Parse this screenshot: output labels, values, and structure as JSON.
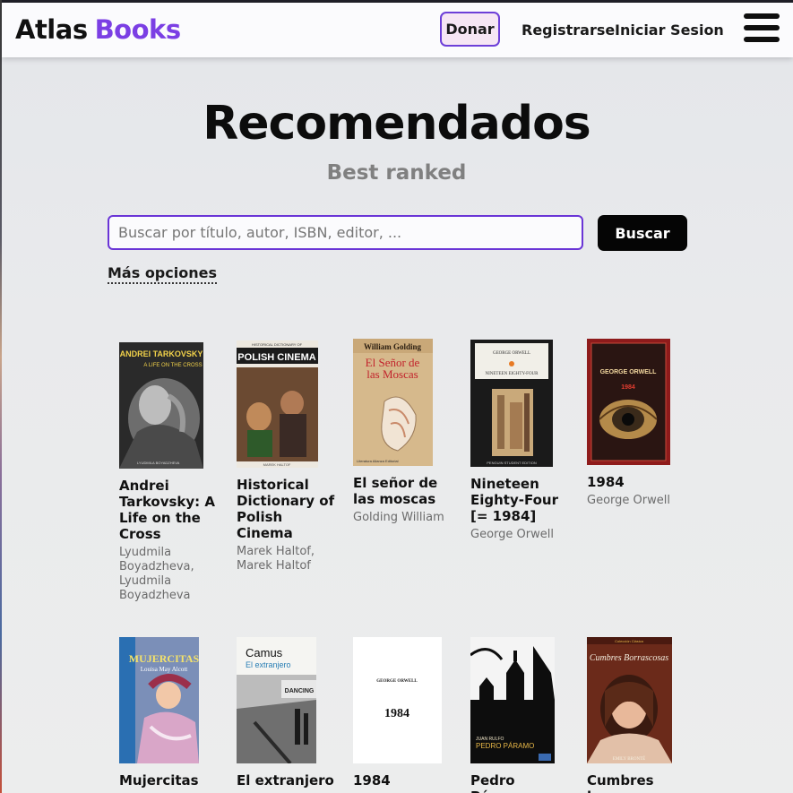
{
  "header": {
    "logo_part1": "Atlas",
    "logo_part2": "Books",
    "donate_label": "Donar",
    "register_label": "Registrarse",
    "login_label": "Iniciar Sesion",
    "menu_icon": "hamburger-menu-icon"
  },
  "main": {
    "title": "Recomendados",
    "subtitle": "Best ranked",
    "search": {
      "placeholder": "Buscar por título, autor, ISBN, editor, ...",
      "value": "",
      "button_label": "Buscar"
    },
    "more_options_label": "Más opciones"
  },
  "books": [
    {
      "title": "Andrei Tarkovsky: A Life on the Cross",
      "author": "Lyudmila Boyadzheva, Lyudmila Boyadzheva",
      "cover_title": "ANDREI TARKOVSKY",
      "cover_subtitle": "A LIFE ON THE CROSS",
      "cover_footer": "LYUDMILA BOYADZHEVA"
    },
    {
      "title": "Historical Dictionary of Polish Cinema",
      "author": "Marek Haltof, Marek Haltof",
      "cover_title": "POLISH CINEMA",
      "cover_subtitle": "HISTORICAL DICTIONARY OF",
      "cover_footer": "MAREK HALTOF"
    },
    {
      "title": "El señor de las moscas",
      "author": "Golding William",
      "cover_title": "El Señor de las Moscas",
      "cover_subtitle": "William Golding",
      "cover_footer": "Literatura Alianza Editorial"
    },
    {
      "title": "Nineteen Eighty-Four [= 1984]",
      "author": "George Orwell",
      "cover_title": "NINETEEN EIGHTY-FOUR",
      "cover_subtitle": "GEORGE ORWELL",
      "cover_footer": "PENGUIN STUDENT EDITION"
    },
    {
      "title": "1984",
      "author": "George Orwell",
      "cover_title": "GEORGE ORWELL",
      "cover_subtitle": "1984",
      "cover_footer": ""
    },
    {
      "title": "Mujercitas",
      "author": "",
      "cover_title": "MUJERCITAS",
      "cover_subtitle": "Louisa May Alcott",
      "cover_footer": ""
    },
    {
      "title": "El extranjero",
      "author": "",
      "cover_title": "Camus",
      "cover_subtitle": "El extranjero",
      "cover_footer": "DANCING"
    },
    {
      "title": "1984",
      "author": "",
      "cover_title": "GEORGE ORWELL",
      "cover_subtitle": "1984",
      "cover_footer": ""
    },
    {
      "title": "Pedro Páramo",
      "author": "",
      "cover_title": "PEDRO PÁRAMO",
      "cover_subtitle": "JUAN RULFO",
      "cover_footer": ""
    },
    {
      "title": "Cumbres borrascosas",
      "author": "",
      "cover_title": "Cumbres Borrascosas",
      "cover_subtitle": "EMILY BRONTË",
      "cover_footer": "Colección Clásica"
    }
  ]
}
